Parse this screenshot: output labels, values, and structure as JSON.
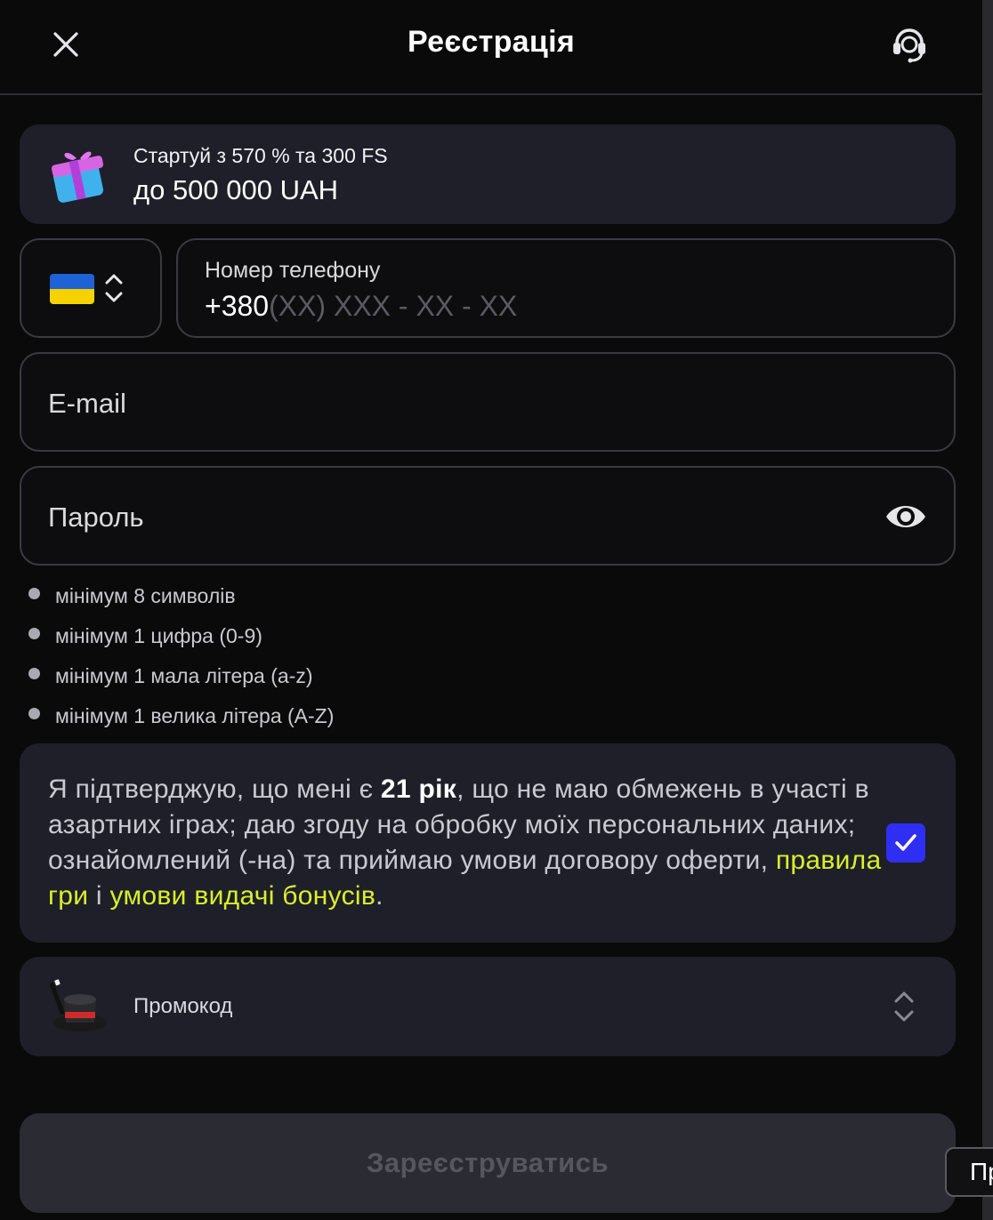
{
  "header": {
    "title": "Реєстрація",
    "close_icon": "close-icon",
    "support_icon": "headset-icon"
  },
  "bonus": {
    "icon": "gift-icon",
    "line1": "Стартуй з 570 % та 300 FS",
    "line2": "до 500 000 UAH"
  },
  "phone": {
    "country_flag": "ukraine-flag-icon",
    "label": "Номер телефону",
    "prefix": "+380",
    "mask": "(XX) XXX - XX - XX"
  },
  "email": {
    "placeholder": "E-mail"
  },
  "password": {
    "placeholder": "Пароль",
    "toggle_icon": "eye-icon"
  },
  "password_rules": [
    "мінімум 8 символів",
    "мінімум 1 цифра (0-9)",
    "мінімум 1 мала літера (a-z)",
    "мінімум 1 велика літера (A-Z)"
  ],
  "consent": {
    "text_1": "Я підтверджую, що мені є ",
    "age": "21 рік",
    "text_2": ", що не маю обмежень в участі в азартних іграх; даю згоду на обробку моїх персональних даних; ознайомлений (-на) та приймаю умови договору оферти, ",
    "link_rules": "правила гри",
    "text_and": " і ",
    "link_bonus": "умови видачі бонусів",
    "text_end": ".",
    "checked": true,
    "colors": {
      "checkbox": "#2f2ff4",
      "link": "#d8f02b"
    }
  },
  "promo": {
    "icon": "magic-hat-icon",
    "label": "Промокод"
  },
  "submit": {
    "label": "Зареєструватись"
  },
  "edge_button": {
    "label": "Пр"
  }
}
